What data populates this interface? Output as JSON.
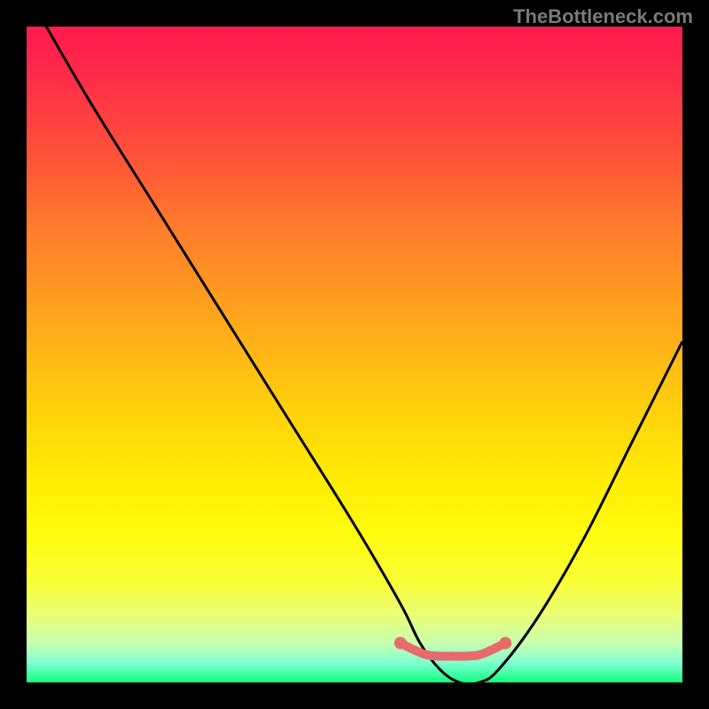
{
  "watermark": "TheBottleneck.com",
  "chart_data": {
    "type": "line",
    "title": "",
    "xlabel": "",
    "ylabel": "",
    "xlim": [
      0,
      100
    ],
    "ylim": [
      0,
      100
    ],
    "grid": false,
    "legend": false,
    "series": [
      {
        "name": "bottleneck-curve",
        "color": "#000000",
        "x": [
          3,
          10,
          20,
          30,
          40,
          50,
          57,
          60,
          63,
          66,
          69,
          72,
          78,
          85,
          92,
          100
        ],
        "y": [
          100,
          88,
          72,
          56,
          40,
          24,
          12,
          6,
          2,
          0,
          0,
          2,
          10,
          22,
          36,
          52
        ]
      },
      {
        "name": "optimal-zone-marker",
        "color": "#e86a6a",
        "x": [
          57,
          59,
          61,
          63,
          65,
          67,
          69,
          71,
          73
        ],
        "y": [
          6,
          5,
          4.2,
          4,
          4,
          4,
          4.2,
          5,
          6
        ]
      }
    ],
    "optimal_range": {
      "start_x": 57,
      "end_x": 73
    },
    "gradient_stops": [
      {
        "pos": 0,
        "color": "#ff1a4d"
      },
      {
        "pos": 50,
        "color": "#ffb716"
      },
      {
        "pos": 80,
        "color": "#fffc10"
      },
      {
        "pos": 100,
        "color": "#10ff80"
      }
    ]
  }
}
